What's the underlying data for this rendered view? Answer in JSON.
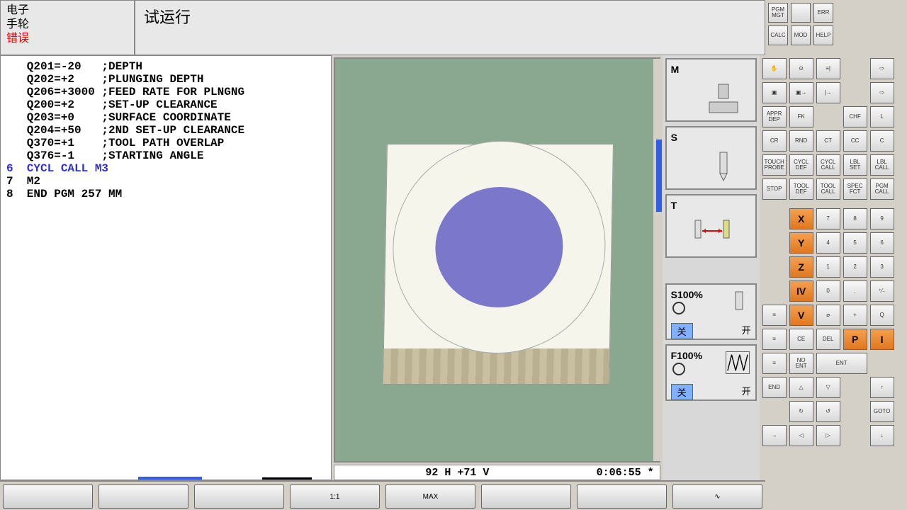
{
  "mode": {
    "line1": "电子",
    "line2": "手轮",
    "line3": "错误"
  },
  "title": "试运行",
  "topkeys": {
    "r1": [
      "PGM\nMGT",
      "",
      "ERR"
    ],
    "r2": [
      "CALC",
      "MOD",
      "HELP"
    ]
  },
  "code": [
    {
      "t": "   Q201=-20   ;DEPTH"
    },
    {
      "t": "   Q202=+2    ;PLUNGING DEPTH"
    },
    {
      "t": "   Q206=+3000 ;FEED RATE FOR PLNGNG"
    },
    {
      "t": "   Q200=+2    ;SET-UP CLEARANCE"
    },
    {
      "t": "   Q203=+0    ;SURFACE COORDINATE"
    },
    {
      "t": "   Q204=+50   ;2ND SET-UP CLEARANCE"
    },
    {
      "t": "   Q370=+1    ;TOOL PATH OVERLAP"
    },
    {
      "t": "   Q376=-1    ;STARTING ANGLE"
    },
    {
      "t": "6  CYCL CALL M3",
      "c": "blue"
    },
    {
      "t": "7  M2"
    },
    {
      "t": "8  END PGM 257 MM"
    }
  ],
  "status": {
    "left": "92 H +71 V",
    "right": "0:06:55 *"
  },
  "panels": {
    "M": "M",
    "S": "S",
    "T": "T",
    "s100": "S100%",
    "f100": "F100%",
    "off": "关",
    "on": "开"
  },
  "iconkeys": {
    "r1": [
      "✋",
      "⊙",
      "≡|",
      "",
      "⇨"
    ],
    "r2": [
      "▣",
      "▣→",
      "|→",
      "",
      "⇨"
    ],
    "r3": [
      "APPR\nDEP",
      "FK",
      "",
      "CHF",
      "L"
    ],
    "r4": [
      "CR",
      "RND",
      "CT",
      "CC",
      "C"
    ],
    "r5": [
      "TOUCH\nPROBE",
      "CYCL\nDEF",
      "CYCL\nCALL",
      "LBL\nSET",
      "LBL\nCALL"
    ],
    "r6": [
      "STOP",
      "TOOL\nDEF",
      "TOOL\nCALL",
      "SPEC\nFCT",
      "PGM\nCALL"
    ]
  },
  "numpad": [
    [
      "",
      "X",
      "7",
      "8",
      "9"
    ],
    [
      "",
      "Y",
      "4",
      "5",
      "6"
    ],
    [
      "",
      "Z",
      "1",
      "2",
      "3"
    ],
    [
      "",
      "IV",
      "0",
      ".",
      "⁺⁄₋"
    ],
    [
      "≡",
      "V",
      "⌀",
      "+",
      "Q"
    ],
    [
      "≡",
      "CE",
      "DEL",
      "P",
      "I"
    ],
    [
      "≡",
      "NO\nENT",
      "ENT",
      "",
      "END"
    ],
    [
      "△",
      "▽",
      "",
      "↑",
      ""
    ],
    [
      "↻",
      "↺",
      "",
      "GOTO",
      "→"
    ],
    [
      "◁",
      "▷",
      "",
      "↓",
      ""
    ]
  ],
  "orange_cells": [
    "X",
    "Y",
    "Z",
    "IV",
    "V",
    "P",
    "I"
  ],
  "softkeys": [
    "",
    "",
    "",
    "1:1",
    "MAX",
    "",
    "",
    "∿"
  ]
}
